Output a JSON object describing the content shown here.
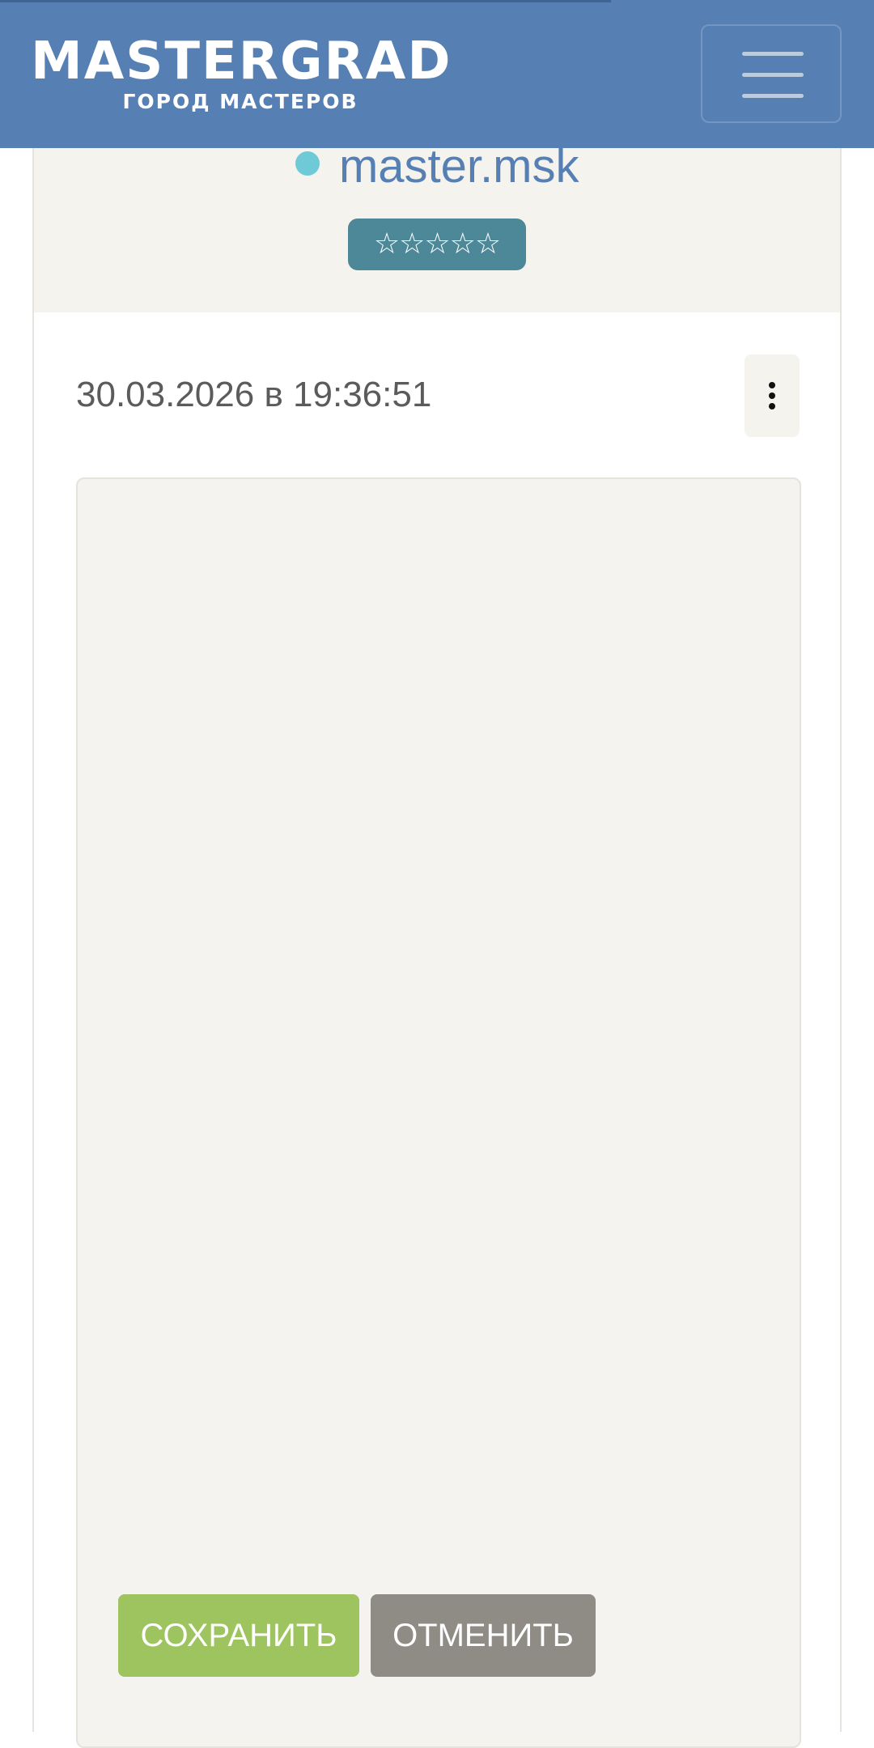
{
  "header": {
    "logo_main": "MASTERGRAD",
    "logo_sub": "ГОРОД МАСТЕРОВ",
    "menu_icon": "hamburger-menu-icon",
    "background_color": "#567fb3"
  },
  "profile": {
    "username": "master.msk",
    "status_color": "#6ecad6",
    "rating_stars": "☆☆☆☆☆",
    "rating_value": 0,
    "rating_max": 5
  },
  "post": {
    "timestamp": "30.03.2026 в 19:36:51",
    "more_icon": "more-vertical-icon",
    "editor_value": ""
  },
  "actions": {
    "save_label": "СОХРАНИТЬ",
    "cancel_label": "ОТМЕНИТЬ",
    "save_color": "#9dc45e",
    "cancel_color": "#8f8c86"
  }
}
